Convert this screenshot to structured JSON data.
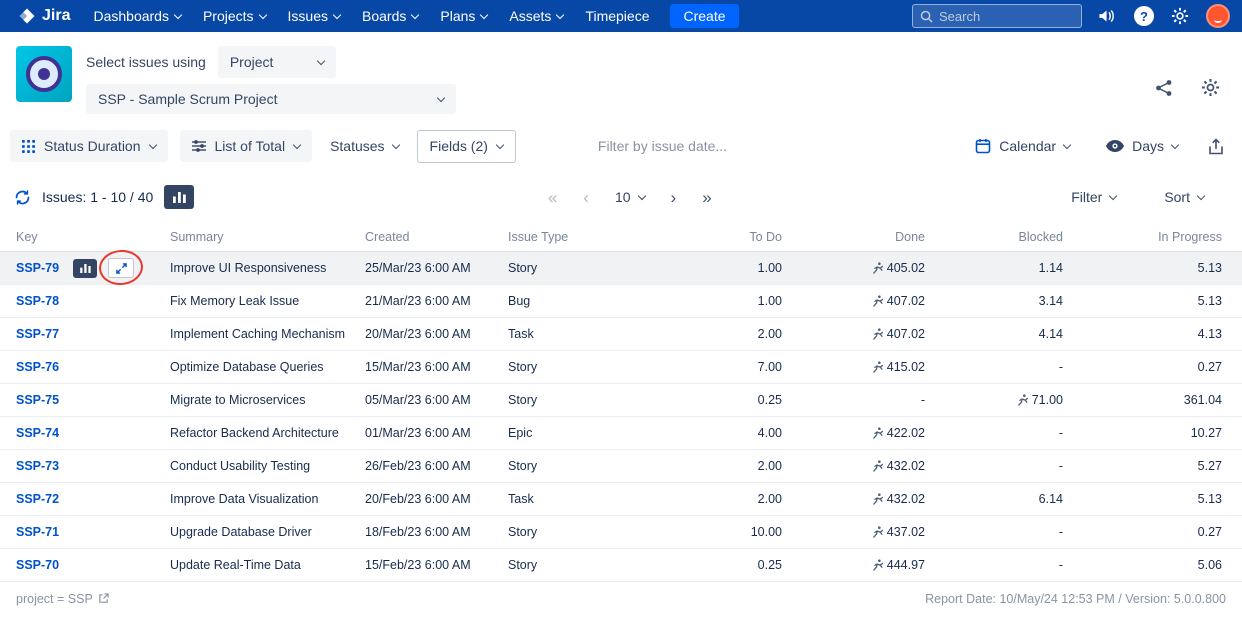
{
  "colors": {
    "nav_bg": "#0747A6",
    "create_bg": "#0065FF",
    "accent": "#0052CC",
    "link": "#0052CC",
    "row_highlight": "#F1F2F4",
    "annotation": "#E5382F"
  },
  "topnav": {
    "brand": "Jira",
    "items": [
      {
        "label": "Dashboards",
        "chevron": true
      },
      {
        "label": "Projects",
        "chevron": true
      },
      {
        "label": "Issues",
        "chevron": true
      },
      {
        "label": "Boards",
        "chevron": true
      },
      {
        "label": "Plans",
        "chevron": true
      },
      {
        "label": "Assets",
        "chevron": true
      },
      {
        "label": "Timepiece",
        "chevron": false
      }
    ],
    "create_label": "Create",
    "search_placeholder": "Search",
    "help_glyph": "?"
  },
  "header": {
    "select_label": "Select issues using",
    "issues_source": "Project",
    "project": "SSP - Sample Scrum Project"
  },
  "toolbar": {
    "report_type": "Status Duration",
    "list_mode": "List of Total",
    "statuses": "Statuses",
    "fields": "Fields (2)",
    "date_filter_placeholder": "Filter by issue date...",
    "calendar": "Calendar",
    "unit": "Days"
  },
  "pagination": {
    "issues_label": "Issues: 1 - 10 / 40",
    "first": "«",
    "prev": "‹",
    "page_size": "10",
    "next": "›",
    "last": "»",
    "filter": "Filter",
    "sort": "Sort"
  },
  "table": {
    "columns": [
      {
        "label": "Key",
        "align": "left"
      },
      {
        "label": "Summary",
        "align": "left"
      },
      {
        "label": "Created",
        "align": "left"
      },
      {
        "label": "Issue Type",
        "align": "left"
      },
      {
        "label": "To Do",
        "align": "right"
      },
      {
        "label": "Done",
        "align": "right"
      },
      {
        "label": "Blocked",
        "align": "right"
      },
      {
        "label": "In Progress",
        "align": "right"
      }
    ],
    "rows": [
      {
        "key": "SSP-79",
        "summary": "Improve UI Responsiveness",
        "created": "25/Mar/23 6:00 AM",
        "type": "Story",
        "todo": "1.00",
        "done": "405.02",
        "done_icon": true,
        "blocked": "1.14",
        "blocked_icon": false,
        "in_progress": "5.13",
        "highlight": true,
        "tools": true
      },
      {
        "key": "SSP-78",
        "summary": "Fix Memory Leak Issue",
        "created": "21/Mar/23 6:00 AM",
        "type": "Bug",
        "todo": "1.00",
        "done": "407.02",
        "done_icon": true,
        "blocked": "3.14",
        "blocked_icon": false,
        "in_progress": "5.13",
        "highlight": false,
        "tools": false
      },
      {
        "key": "SSP-77",
        "summary": "Implement Caching Mechanism",
        "created": "20/Mar/23 6:00 AM",
        "type": "Task",
        "todo": "2.00",
        "done": "407.02",
        "done_icon": true,
        "blocked": "4.14",
        "blocked_icon": false,
        "in_progress": "4.13",
        "highlight": false,
        "tools": false
      },
      {
        "key": "SSP-76",
        "summary": "Optimize Database Queries",
        "created": "15/Mar/23 6:00 AM",
        "type": "Story",
        "todo": "7.00",
        "done": "415.02",
        "done_icon": true,
        "blocked": "-",
        "blocked_icon": false,
        "in_progress": "0.27",
        "highlight": false,
        "tools": false
      },
      {
        "key": "SSP-75",
        "summary": "Migrate to Microservices",
        "created": "05/Mar/23 6:00 AM",
        "type": "Story",
        "todo": "0.25",
        "done": "-",
        "done_icon": false,
        "blocked": "71.00",
        "blocked_icon": true,
        "in_progress": "361.04",
        "highlight": false,
        "tools": false
      },
      {
        "key": "SSP-74",
        "summary": "Refactor Backend Architecture",
        "created": "01/Mar/23 6:00 AM",
        "type": "Epic",
        "todo": "4.00",
        "done": "422.02",
        "done_icon": true,
        "blocked": "-",
        "blocked_icon": false,
        "in_progress": "10.27",
        "highlight": false,
        "tools": false
      },
      {
        "key": "SSP-73",
        "summary": "Conduct Usability Testing",
        "created": "26/Feb/23 6:00 AM",
        "type": "Story",
        "todo": "2.00",
        "done": "432.02",
        "done_icon": true,
        "blocked": "-",
        "blocked_icon": false,
        "in_progress": "5.27",
        "highlight": false,
        "tools": false
      },
      {
        "key": "SSP-72",
        "summary": "Improve Data Visualization",
        "created": "20/Feb/23 6:00 AM",
        "type": "Task",
        "todo": "2.00",
        "done": "432.02",
        "done_icon": true,
        "blocked": "6.14",
        "blocked_icon": false,
        "in_progress": "5.13",
        "highlight": false,
        "tools": false
      },
      {
        "key": "SSP-71",
        "summary": "Upgrade Database Driver",
        "created": "18/Feb/23 6:00 AM",
        "type": "Story",
        "todo": "10.00",
        "done": "437.02",
        "done_icon": true,
        "blocked": "-",
        "blocked_icon": false,
        "in_progress": "0.27",
        "highlight": false,
        "tools": false
      },
      {
        "key": "SSP-70",
        "summary": "Update Real-Time Data",
        "created": "15/Feb/23 6:00 AM",
        "type": "Story",
        "todo": "0.25",
        "done": "444.97",
        "done_icon": true,
        "blocked": "-",
        "blocked_icon": false,
        "in_progress": "5.06",
        "highlight": false,
        "tools": false
      }
    ]
  },
  "footer": {
    "query": "project = SSP",
    "report_info": "Report Date: 10/May/24 12:53 PM / Version: 5.0.0.800"
  }
}
